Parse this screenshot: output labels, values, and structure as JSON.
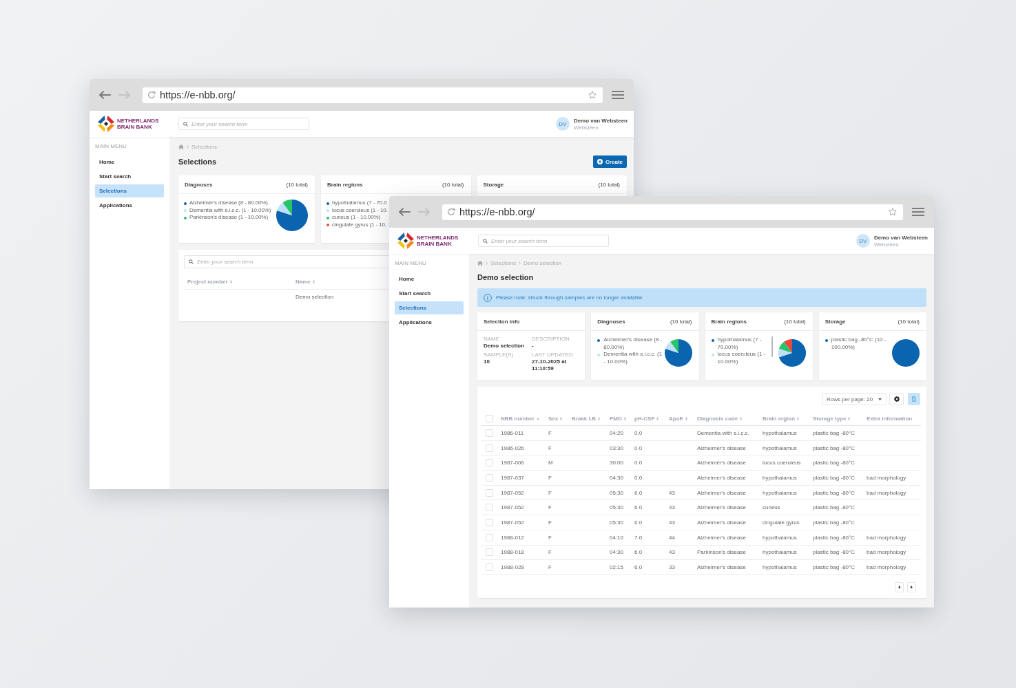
{
  "background_window": {
    "browser": {
      "back_button": {
        "disabled": false
      },
      "forward_button": {
        "disabled": true
      },
      "url": "https://e-nbb.org/"
    },
    "app_header": {
      "logo_text": [
        "NETHERLANDS",
        "BRAIN BANK"
      ],
      "search": {
        "placeholder": "Enter your search term"
      },
      "user": {
        "initials": "DV",
        "name": "Demo van Websteen",
        "organization": "Websteen"
      }
    },
    "sidebar": {
      "heading": "MAIN MENU",
      "items": [
        {
          "label": "Home",
          "selected": false
        },
        {
          "label": "Start search",
          "selected": false
        },
        {
          "label": "Selections",
          "selected": true
        },
        {
          "label": "Applications",
          "selected": false
        }
      ]
    },
    "breadcrumb": [
      "Selections"
    ],
    "title": "Selections",
    "create_button": {
      "label": "Create"
    },
    "cards": [
      {
        "title": "Diagnoses",
        "total": "(10 total)",
        "legend": [
          {
            "label": "Alzheimer's disease (8 - 80.00%)",
            "color": "#0b64b0"
          },
          {
            "label": "Dementia with s.i.c.c. (1 - 10.00%)",
            "color": "#bfe0f7"
          },
          {
            "label": "Parkinson's disease (1 - 10.00%)",
            "color": "#27c46b"
          }
        ],
        "chart_data": {
          "type": "pie",
          "values": [
            80,
            10,
            10
          ],
          "colors": [
            "#0b64b0",
            "#bfe0f7",
            "#27c46b"
          ]
        }
      },
      {
        "title": "Brain regions",
        "total": "(10 total)",
        "legend": [
          {
            "label": "hypothalamus (7 - 70.0",
            "color": "#0b64b0"
          },
          {
            "label": "locus coeruleus (1 - 10.",
            "color": "#bfe0f7"
          },
          {
            "label": "cuneus (1 - 10.00%)",
            "color": "#27c46b"
          },
          {
            "label": "cingulate gyrus (1 - 10.",
            "color": "#e8483d"
          }
        ]
      },
      {
        "title": "Storage",
        "total": "(10 total)"
      }
    ],
    "selections_table": {
      "search": {
        "placeholder": "Enter your search term"
      },
      "columns": [
        {
          "label": "Project number",
          "sortable": true,
          "sorted": false
        },
        {
          "label": "Name",
          "sortable": true,
          "sorted": false
        }
      ],
      "rows": [
        [
          null,
          "Demo selection"
        ]
      ]
    }
  },
  "foreground_window": {
    "browser": {
      "back_button": {
        "disabled": false
      },
      "forward_button": {
        "disabled": true
      },
      "url": "https://e-nbb.org/"
    },
    "app_header": {
      "logo_text": [
        "NETHERLANDS",
        "BRAIN BANK"
      ],
      "search": {
        "placeholder": "Enter your search term"
      },
      "user": {
        "initials": "DV",
        "name": "Demo van Websteen",
        "organization": "Websteen"
      }
    },
    "sidebar": {
      "heading": "MAIN MENU",
      "items": [
        {
          "label": "Home",
          "selected": false
        },
        {
          "label": "Start search",
          "selected": false
        },
        {
          "label": "Selections",
          "selected": true
        },
        {
          "label": "Applications",
          "selected": false
        }
      ]
    },
    "breadcrumb": [
      "Selections",
      "Demo selection"
    ],
    "title": "Demo selection",
    "notice": "Please note: struck through samples are no longer available.",
    "cards": [
      {
        "kind": "info",
        "title": "Selection info",
        "scrollbar": false,
        "fields": [
          {
            "label": "NAME",
            "value": "Demo selection"
          },
          {
            "label": "DESCRIPTION",
            "value": "-"
          },
          {
            "label": "SAMPLE(S)",
            "value": "10"
          },
          {
            "label": "LAST UPDATED",
            "value": "27-10-2025 at 11:10:59"
          }
        ]
      },
      {
        "kind": "distribution",
        "title": "Diagnoses",
        "total": "(10 total)",
        "scrollbar": false,
        "legend": [
          {
            "label": "Alzheimer's disease (8 - 80.00%)",
            "color": "#0b64b0"
          },
          {
            "label": "Dementia with s.i.c.c. (1 - 10.00%)",
            "color": "#bfe0f7"
          }
        ],
        "chart_data": {
          "type": "pie",
          "values": [
            80,
            10,
            10
          ],
          "colors": [
            "#0b64b0",
            "#bfe0f7",
            "#27c46b"
          ]
        }
      },
      {
        "kind": "distribution",
        "title": "Brain regions",
        "total": "(10 total)",
        "scrollbar": true,
        "legend": [
          {
            "label": "hypothalamus (7 - 70.00%)",
            "color": "#0b64b0"
          },
          {
            "label": "locus coeruleus (1 - 10.00%)",
            "color": "#bfe0f7"
          }
        ],
        "chart_data": {
          "type": "pie",
          "values": [
            70,
            10,
            10,
            10
          ],
          "colors": [
            "#0b64b0",
            "#bfe0f7",
            "#27c46b",
            "#e8483d"
          ]
        }
      },
      {
        "kind": "distribution",
        "title": "Storage",
        "total": "(10 total)",
        "scrollbar": false,
        "legend": [
          {
            "label": "plastic bag -80°C (10 - 100.00%)",
            "color": "#0b64b0"
          }
        ],
        "chart_data": {
          "type": "pie",
          "values": [
            100
          ],
          "colors": [
            "#0b64b0"
          ]
        }
      }
    ],
    "samples_table": {
      "rows_per_page": "Rows per page: 20",
      "select_all": {
        "checked": false
      },
      "columns": [
        {
          "label": "NBB number",
          "sortable": true,
          "sorted": true
        },
        {
          "label": "Sex",
          "sortable": true,
          "sorted": false
        },
        {
          "label": "Braak LB",
          "sortable": true,
          "sorted": false
        },
        {
          "label": "PMD",
          "sortable": true,
          "sorted": false
        },
        {
          "label": "pH-CSF",
          "sortable": true,
          "sorted": false
        },
        {
          "label": "ApoE",
          "sortable": true,
          "sorted": false
        },
        {
          "label": "Diagnosis code",
          "sortable": true,
          "sorted": false
        },
        {
          "label": "Brain region",
          "sortable": true,
          "sorted": false
        },
        {
          "label": "Storage type",
          "sortable": true,
          "sorted": false
        },
        {
          "label": "Extra information",
          "sortable": false,
          "sorted": false
        }
      ],
      "rows": [
        {
          "checked": false,
          "cells": [
            "1986-011",
            "F",
            null,
            "04:20",
            "0.0",
            null,
            "Dementia with s.i.c.c.",
            "hypothalamus",
            "plastic bag -80°C",
            null
          ]
        },
        {
          "checked": false,
          "cells": [
            "1986-026",
            "F",
            null,
            "03:30",
            "0.0",
            null,
            "Alzheimer's disease",
            "hypothalamus",
            "plastic bag -80°C",
            null
          ]
        },
        {
          "checked": false,
          "cells": [
            "1987-006",
            "M",
            null,
            "30:00",
            "0.0",
            null,
            "Alzheimer's disease",
            "locus coeruleus",
            "plastic bag -80°C",
            null
          ]
        },
        {
          "checked": false,
          "cells": [
            "1987-037",
            "F",
            null,
            "04:30",
            "0.0",
            null,
            "Alzheimer's disease",
            "hypothalamus",
            "plastic bag -80°C",
            "bad morphology"
          ]
        },
        {
          "checked": false,
          "cells": [
            "1987-052",
            "F",
            null,
            "05:30",
            "6.0",
            "43",
            "Alzheimer's disease",
            "hypothalamus",
            "plastic bag -80°C",
            "bad morphology"
          ]
        },
        {
          "checked": false,
          "cells": [
            "1987-052",
            "F",
            null,
            "05:30",
            "6.0",
            "43",
            "Alzheimer's disease",
            "cuneus",
            "plastic bag -80°C",
            null
          ]
        },
        {
          "checked": false,
          "cells": [
            "1987-052",
            "F",
            null,
            "05:30",
            "6.0",
            "43",
            "Alzheimer's disease",
            "cingulate gyrus",
            "plastic bag -80°C",
            null
          ]
        },
        {
          "checked": false,
          "cells": [
            "1988-012",
            "F",
            null,
            "04:10",
            "7.0",
            "44",
            "Alzheimer's disease",
            "hypothalamus",
            "plastic bag -80°C",
            "bad morphology"
          ]
        },
        {
          "checked": false,
          "cells": [
            "1988-018",
            "F",
            null,
            "04:30",
            "6.0",
            "43",
            "Parkinson's disease",
            "hypothalamus",
            "plastic bag -80°C",
            "bad morphology"
          ]
        },
        {
          "checked": false,
          "cells": [
            "1988-028",
            "F",
            null,
            "02:15",
            "6.0",
            "33",
            "Alzheimer's disease",
            "hypothalamus",
            "plastic bag -80°C",
            "bad morphology"
          ]
        }
      ]
    }
  }
}
